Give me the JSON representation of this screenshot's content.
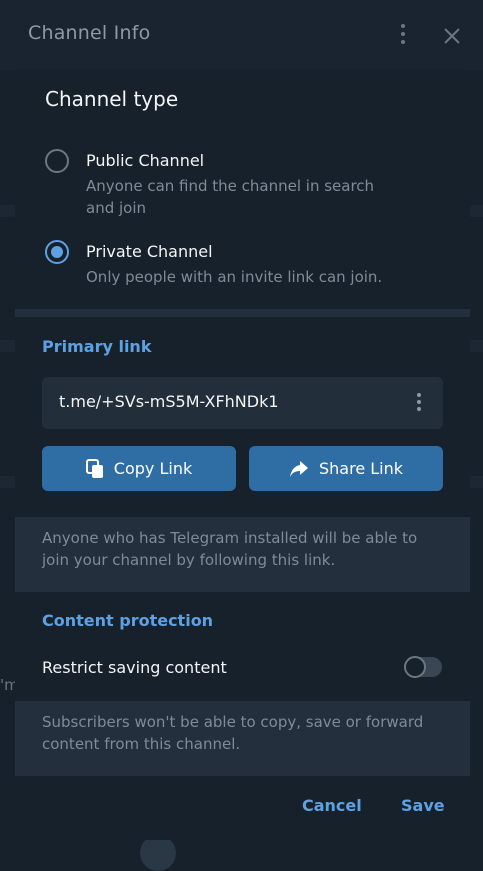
{
  "background": {
    "title": "Channel Info",
    "fragment": "'m"
  },
  "dialog": {
    "title": "Channel type",
    "options": [
      {
        "label": "Public Channel",
        "description": "Anyone can find the channel in search and join",
        "selected": false
      },
      {
        "label": "Private Channel",
        "description": "Only people with an invite link can join.",
        "selected": true
      }
    ],
    "primary_link": {
      "section_title": "Primary link",
      "value": "t.me/+SVs-mS5M-XFhNDk1",
      "copy_label": "Copy Link",
      "share_label": "Share Link",
      "info": "Anyone who has Telegram installed will be able to join your channel by following this link."
    },
    "content_protection": {
      "section_title": "Content protection",
      "toggle_label": "Restrict saving content",
      "enabled": false,
      "info": "Subscribers won't be able to copy, save or forward content from this channel."
    },
    "footer": {
      "cancel_label": "Cancel",
      "save_label": "Save"
    }
  },
  "colors": {
    "accent": "#5ea1e3",
    "button": "#2f6ea5",
    "panel": "#17212b"
  },
  "icons": [
    "more-vertical-icon",
    "close-icon",
    "copy-icon",
    "share-arrow-icon"
  ]
}
